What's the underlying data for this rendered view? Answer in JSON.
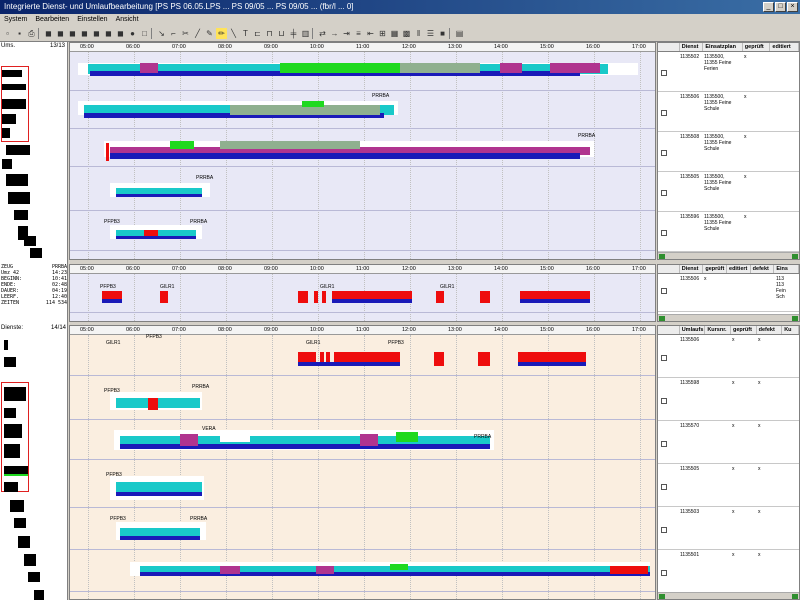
{
  "window": {
    "title": "Integrierte Dienst- und Umlaufbearbeitung [PS  PS 06.05.LPS  ...  PS 09/05 ... PS 09/05 ... (fbr/l ... 0]",
    "min": "_",
    "max": "□",
    "close": "×"
  },
  "menu": [
    "System",
    "Bearbeiten",
    "Einstellen",
    "Ansicht"
  ],
  "left_panel": {
    "top_label": "Ums.",
    "top_count": "13/13",
    "bottom_label": "Dienste:",
    "bottom_count": "14/14",
    "info_lines": [
      [
        "ZEUG",
        "PRRBA"
      ],
      [
        "Umz 42",
        "14:23"
      ],
      [
        "BEGINN:",
        "10:41"
      ],
      [
        "ENDE:",
        "02:48"
      ],
      [
        "DAUER:",
        "04:19"
      ],
      [
        "LEERF.",
        "12:40"
      ],
      [
        "ZEITEN",
        "114 534"
      ]
    ]
  },
  "ruler_labels": [
    "05:00",
    "06:00",
    "07:00",
    "08:00",
    "09:00",
    "10:00",
    "11:00",
    "12:00",
    "13:00",
    "14:00",
    "15:00",
    "16:00",
    "17:00"
  ],
  "right_panel_1": {
    "columns": [
      "Dienst",
      "Einsatzplan",
      "geprüft",
      "editiert"
    ],
    "rows": [
      {
        "dienst": "1135502",
        "plan": "1135500,\n11355 Feine\nFerien",
        "gepr": "x"
      },
      {
        "dienst": "1135506",
        "plan": "1135500,\n11355 Feine\nSchule",
        "gepr": "x"
      },
      {
        "dienst": "1135508",
        "plan": "1135500,\n11355 Feine\nSchule",
        "gepr": "x"
      },
      {
        "dienst": "1135505",
        "plan": "1135500,\n11355 Feine\nSchule",
        "gepr": "x"
      },
      {
        "dienst": "1135596",
        "plan": "1135500,\n11355 Feine\nSchule",
        "gepr": "x"
      }
    ]
  },
  "right_panel_2": {
    "columns": [
      "Dienst",
      "geprüft",
      "editiert",
      "defekt",
      "Eins"
    ],
    "rows": [
      {
        "dienst": "1135506",
        "gepr": "x",
        "extra": "113\n113\nFein\nSch"
      }
    ]
  },
  "right_panel_3": {
    "columns": [
      "Umlaufs",
      "Kursnr.",
      "geprüft",
      "defekt",
      "Ku"
    ],
    "rows": [
      {
        "dienst": "1135506",
        "gepr": "x",
        "def": "x"
      },
      {
        "dienst": "1135598",
        "gepr": "x",
        "def": "x"
      },
      {
        "dienst": "1135570",
        "gepr": "x",
        "def": "x"
      },
      {
        "dienst": "1135505",
        "gepr": "x",
        "def": "x"
      },
      {
        "dienst": "1135503",
        "gepr": "x",
        "def": "x"
      },
      {
        "dienst": "1135501",
        "gepr": "x",
        "def": "x"
      }
    ]
  },
  "gantt_labels": {
    "prrba": "PRRBA",
    "pfpb": "PFPB3",
    "gilr": "GILR1",
    "pfpb2": "PFPB2",
    "vera": "VERA"
  },
  "colors": {
    "blue": "#1a1ab8",
    "cyan": "#19c9c9",
    "green": "#1fd91f",
    "purple": "#b0348f",
    "red": "#ee0d0d",
    "sage": "#8fb08f",
    "lav": "#e6e6f5",
    "peach": "#faebd7"
  }
}
